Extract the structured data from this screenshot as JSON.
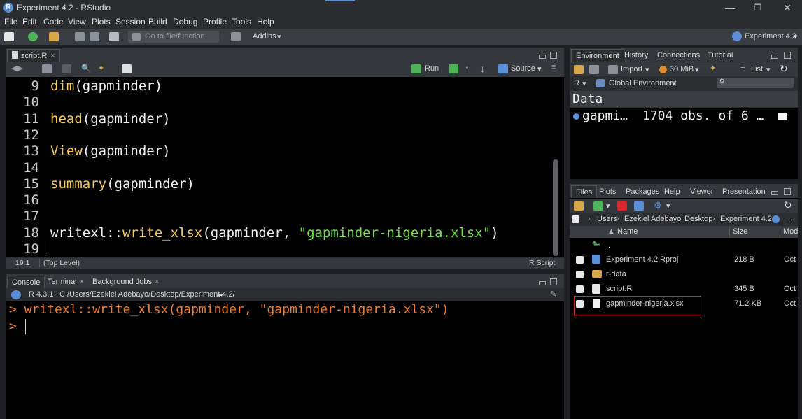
{
  "window": {
    "title": "Experiment 4.2 - RStudio",
    "logo": "R",
    "project": "Experiment 4.2"
  },
  "menu": [
    "File",
    "Edit",
    "Code",
    "View",
    "Plots",
    "Session",
    "Build",
    "Debug",
    "Profile",
    "Tools",
    "Help"
  ],
  "toolbar": {
    "goto_placeholder": "Go to file/function",
    "addins": "Addins"
  },
  "editor": {
    "tab": "script.R",
    "run_label": "Run",
    "source_label": "Source",
    "lines": [
      {
        "num": "9",
        "parts": [
          {
            "t": "dim",
            "c": "fn"
          },
          {
            "t": "(gapminder)",
            "c": ""
          }
        ]
      },
      {
        "num": "10",
        "parts": []
      },
      {
        "num": "11",
        "parts": [
          {
            "t": "head",
            "c": "fn"
          },
          {
            "t": "(gapminder)",
            "c": ""
          }
        ]
      },
      {
        "num": "12",
        "parts": []
      },
      {
        "num": "13",
        "parts": [
          {
            "t": "View",
            "c": "fn"
          },
          {
            "t": "(gapminder)",
            "c": ""
          }
        ]
      },
      {
        "num": "14",
        "parts": []
      },
      {
        "num": "15",
        "parts": [
          {
            "t": "summary",
            "c": "fn"
          },
          {
            "t": "(gapminder)",
            "c": ""
          }
        ]
      },
      {
        "num": "16",
        "parts": []
      },
      {
        "num": "17",
        "parts": []
      },
      {
        "num": "18",
        "parts": [
          {
            "t": "writexl::",
            "c": ""
          },
          {
            "t": "write_xlsx",
            "c": "fn"
          },
          {
            "t": "(gapminder, ",
            "c": ""
          },
          {
            "t": "\"gapminder-nigeria.xlsx\"",
            "c": "str"
          },
          {
            "t": ")",
            "c": ""
          }
        ]
      },
      {
        "num": "19",
        "parts": []
      }
    ],
    "status_pos": "19:1",
    "status_level": "(Top Level)",
    "status_type": "R Script"
  },
  "console": {
    "tabs": [
      "Console",
      "Terminal",
      "Background Jobs"
    ],
    "r_version": "R 4.3.1",
    "path": "C:/Users/Ezekiel Adebayo/Desktop/Experiment 4.2/",
    "command": "> writexl::write_xlsx(gapminder, \"gapminder-nigeria.xlsx\")",
    "prompt": ">"
  },
  "environment": {
    "tabs": [
      "Environment",
      "History",
      "Connections",
      "Tutorial"
    ],
    "import_label": "Import",
    "memory": "30 MiB",
    "list_label": "List",
    "lang": "R",
    "scope": "Global Environment",
    "section": "Data",
    "var_name": "gapmi…",
    "var_value": "1704 obs. of 6 …"
  },
  "files": {
    "tabs": [
      "Files",
      "Plots",
      "Packages",
      "Help",
      "Viewer",
      "Presentation"
    ],
    "breadcrumb": [
      "Users",
      "Ezekiel Adebayo",
      "Desktop",
      "Experiment 4.2"
    ],
    "col_name": "Name",
    "col_size": "Size",
    "col_mod": "Mod",
    "up": "..",
    "rows": [
      {
        "name": "Experiment 4.2.Rproj",
        "size": "218 B",
        "mod": "Oct"
      },
      {
        "name": "r-data",
        "size": "",
        "mod": ""
      },
      {
        "name": "script.R",
        "size": "345 B",
        "mod": "Oct"
      },
      {
        "name": "gapminder-nigeria.xlsx",
        "size": "71.2 KB",
        "mod": "Oct"
      }
    ]
  },
  "colors": {
    "highlight": "#d9262c",
    "fn": "#f6c95e",
    "str": "#6fe04a",
    "console": "#f07b2a"
  }
}
